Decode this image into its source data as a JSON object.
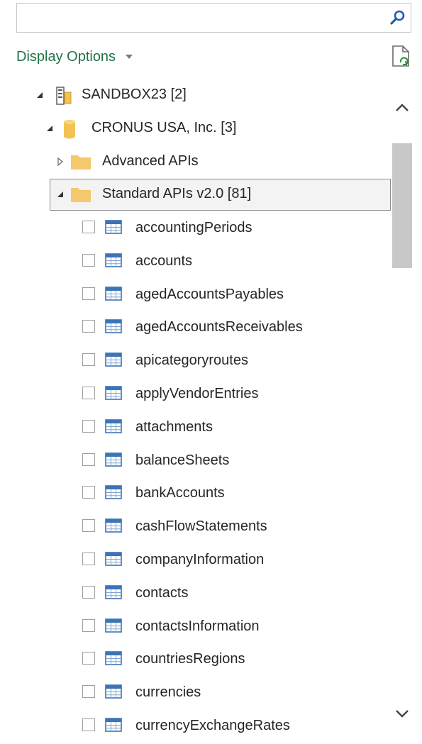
{
  "search": {
    "placeholder": "",
    "value": ""
  },
  "toolbar": {
    "display_options_label": "Display Options"
  },
  "tree": {
    "server": {
      "label": "SANDBOX23 [2]",
      "expanded": true
    },
    "company": {
      "label": "CRONUS USA, Inc. [3]",
      "expanded": true
    },
    "folders": [
      {
        "label": "Advanced APIs",
        "expanded": false
      },
      {
        "label": "Standard APIs v2.0 [81]",
        "expanded": true,
        "selected": true
      }
    ],
    "tables": [
      {
        "label": "accountingPeriods",
        "checked": false
      },
      {
        "label": "accounts",
        "checked": false
      },
      {
        "label": "agedAccountsPayables",
        "checked": false
      },
      {
        "label": "agedAccountsReceivables",
        "checked": false
      },
      {
        "label": "apicategoryroutes",
        "checked": false
      },
      {
        "label": "applyVendorEntries",
        "checked": false
      },
      {
        "label": "attachments",
        "checked": false
      },
      {
        "label": "balanceSheets",
        "checked": false
      },
      {
        "label": "bankAccounts",
        "checked": false
      },
      {
        "label": "cashFlowStatements",
        "checked": false
      },
      {
        "label": "companyInformation",
        "checked": false
      },
      {
        "label": "contacts",
        "checked": false
      },
      {
        "label": "contactsInformation",
        "checked": false
      },
      {
        "label": "countriesRegions",
        "checked": false
      },
      {
        "label": "currencies",
        "checked": false
      },
      {
        "label": "currencyExchangeRates",
        "checked": false
      }
    ]
  },
  "icons": {
    "search": "search-icon",
    "refresh": "refresh-document-icon",
    "server": "server-icon",
    "database": "database-icon",
    "folder": "folder-icon",
    "table": "table-icon"
  },
  "colors": {
    "accent_green": "#217346",
    "search_blue": "#1e5fa8",
    "folder_yellow": "#f4c86b",
    "database_yellow": "#f2c253",
    "table_blue": "#3c74b5"
  }
}
